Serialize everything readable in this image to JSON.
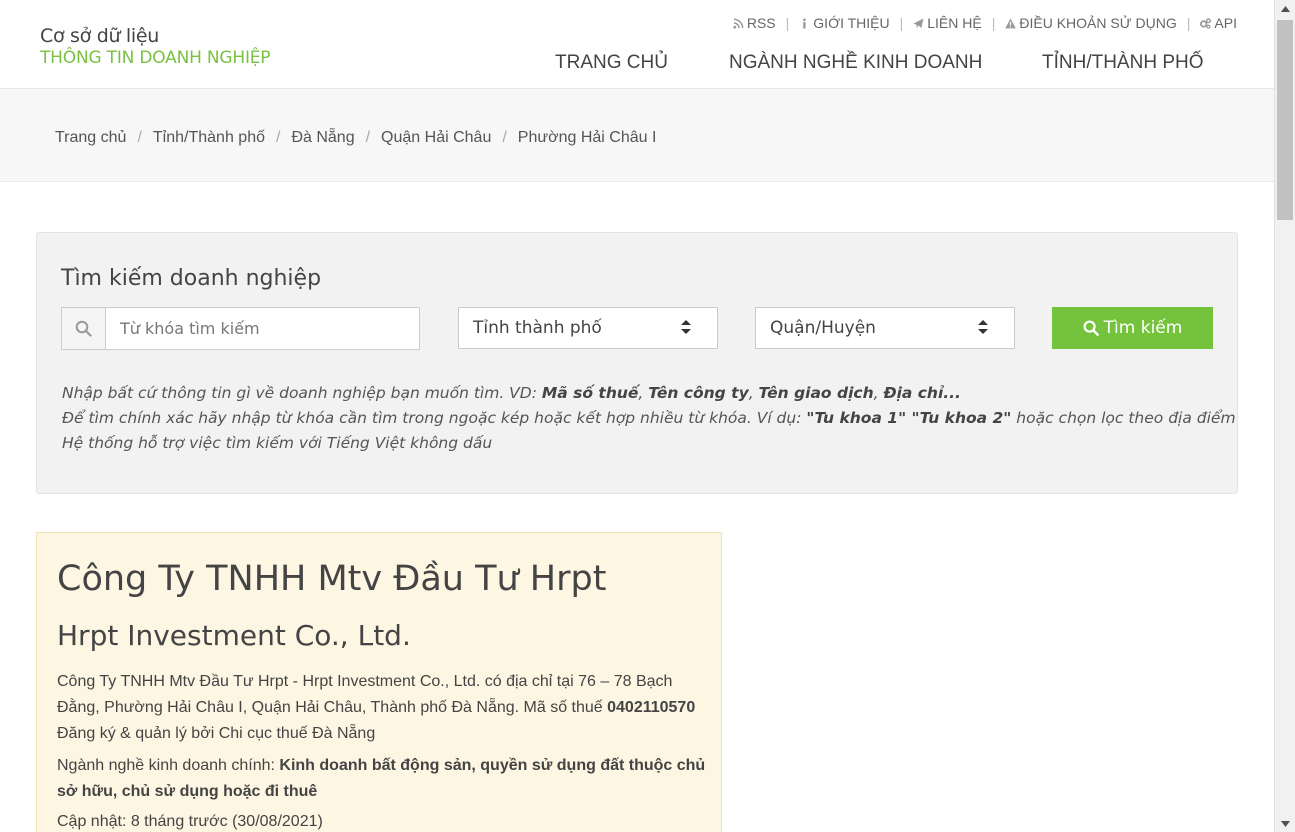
{
  "logo": {
    "line1": "Cơ sở dữ liệu",
    "line2": "THÔNG TIN DOANH NGHIỆP"
  },
  "topnav": [
    {
      "label": "RSS",
      "icon": "rss-icon"
    },
    {
      "label": "GIỚI THIỆU",
      "icon": "info-icon"
    },
    {
      "label": "LIÊN HỆ",
      "icon": "paper-plane-icon"
    },
    {
      "label": "ĐIỀU KHOẢN SỬ DỤNG",
      "icon": "warning-icon"
    },
    {
      "label": "API",
      "icon": "gears-icon"
    }
  ],
  "mainnav": [
    "TRANG CHỦ",
    "NGÀNH NGHỀ KINH DOANH",
    "TỈNH/THÀNH PHỐ"
  ],
  "breadcrumb": [
    "Trang chủ",
    "Tỉnh/Thành phố",
    "Đà Nẵng",
    "Quận Hải Châu",
    "Phường Hải Châu I"
  ],
  "search": {
    "title": "Tìm kiếm doanh nghiệp",
    "placeholder": "Từ khóa tìm kiếm",
    "province": "Tỉnh thành phố",
    "district": "Quận/Huyện",
    "button": "Tìm kiếm",
    "help1_pre": "Nhập bất cứ thông tin gì về doanh nghiệp bạn muốn tìm. VD: ",
    "help1_b1": "Mã số thuế",
    "help1_b2": "Tên công ty",
    "help1_b3": "Tên giao dịch",
    "help1_b4": "Địa chỉ",
    "help1_end": "...",
    "help2_pre": "Để tìm chính xác hãy nhập từ khóa cần tìm trong ngoặc kép hoặc kết hợp nhiều từ khóa. Ví dụ: ",
    "help2_b": "\"Tu khoa 1\" \"Tu khoa 2\"",
    "help2_post": " hoặc chọn lọc theo địa điểm",
    "help3": "Hệ thống hỗ trợ việc tìm kiếm với Tiếng Việt không dấu"
  },
  "company": {
    "name": "Công Ty TNHH Mtv Đầu Tư Hrpt",
    "name_en": "Hrpt Investment Co., Ltd.",
    "desc_pre": "Công Ty TNHH Mtv Đầu Tư Hrpt - Hrpt Investment Co., Ltd. có địa chỉ tại 76 – 78 Bạch Đằng, Phường Hải Châu I, Quận Hải Châu, Thành phố Đà Nẵng. Mã số thuế ",
    "tax_id": "0402110570",
    "desc_post": " Đăng ký & quản lý bởi Chi cục thuế Đà Nẵng",
    "industry_label": "Ngành nghề kinh doanh chính: ",
    "industry": "Kinh doanh bất động sản, quyền sử dụng đất thuộc chủ sở hữu, chủ sử dụng hoặc đi thuê",
    "updated": "Cập nhật: 8 tháng trước (30/08/2021)"
  },
  "colors": {
    "accent": "#75c23d",
    "logo_green": "#7ac142",
    "card_bg": "#fcf6e3"
  }
}
